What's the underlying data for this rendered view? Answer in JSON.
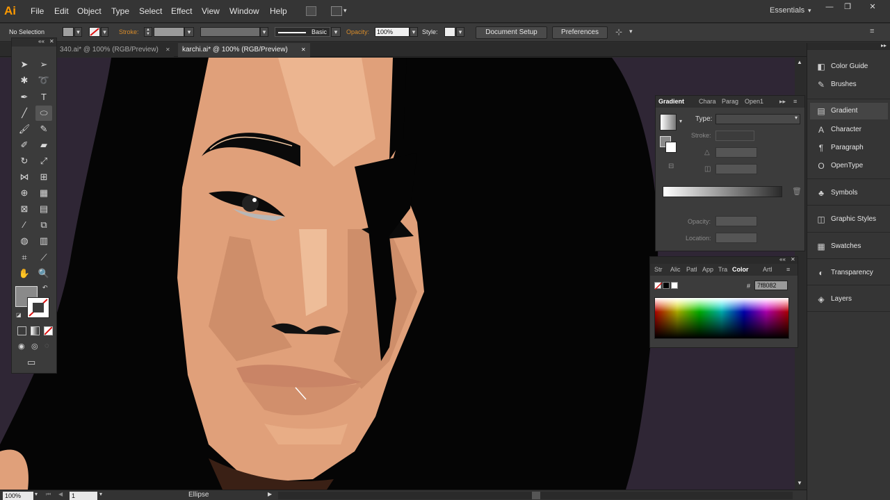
{
  "app": {
    "logo": "Ai"
  },
  "menu": [
    "File",
    "Edit",
    "Object",
    "Type",
    "Select",
    "Effect",
    "View",
    "Window",
    "Help"
  ],
  "workspace": {
    "label": "Essentials",
    "chevron": "▾"
  },
  "window_buttons": [
    "—",
    "❐",
    "✕"
  ],
  "control": {
    "selection": "No Selection",
    "stroke_label": "Stroke:",
    "brush": "Basic",
    "opacity_label": "Opacity:",
    "opacity_value": "100%",
    "style_label": "Style:",
    "document_setup": "Document Setup",
    "preferences": "Preferences"
  },
  "tabs": [
    {
      "label": "340.ai* @ 100% (RGB/Preview)",
      "close": "✕"
    },
    {
      "label": "karchi.ai* @ 100% (RGB/Preview)",
      "close": "✕"
    }
  ],
  "gradient_panel": {
    "tabs": [
      "Gradient",
      "Chara",
      "Parag",
      "Open1"
    ],
    "type_label": "Type:",
    "stroke_label": "Stroke:",
    "opacity_label": "Opacity:",
    "location_label": "Location:"
  },
  "color_panel": {
    "tabs": [
      "Str",
      "Alic",
      "Patl",
      "App",
      "Tra",
      "Color",
      "Artl"
    ],
    "hex_prefix": "#",
    "hex_value": "7f8082"
  },
  "dock": [
    {
      "label": "Color Guide",
      "icon": "color-guide-icon"
    },
    {
      "label": "Brushes",
      "icon": "brushes-icon"
    },
    {
      "label": "Gradient",
      "icon": "gradient-icon"
    },
    {
      "label": "Character",
      "icon": "character-icon"
    },
    {
      "label": "Paragraph",
      "icon": "paragraph-icon"
    },
    {
      "label": "OpenType",
      "icon": "opentype-icon"
    },
    {
      "label": "Symbols",
      "icon": "symbols-icon"
    },
    {
      "label": "Graphic Styles",
      "icon": "graphic-styles-icon"
    },
    {
      "label": "Swatches",
      "icon": "swatches-icon"
    },
    {
      "label": "Transparency",
      "icon": "transparency-icon"
    },
    {
      "label": "Layers",
      "icon": "layers-icon"
    }
  ],
  "status": {
    "zoom": "100%",
    "page": "1",
    "tool": "Ellipse"
  },
  "colors": {
    "accent": "#ff9a00",
    "skin": "#e0a07a",
    "hair": "#050505",
    "bg": "#2f2635"
  }
}
